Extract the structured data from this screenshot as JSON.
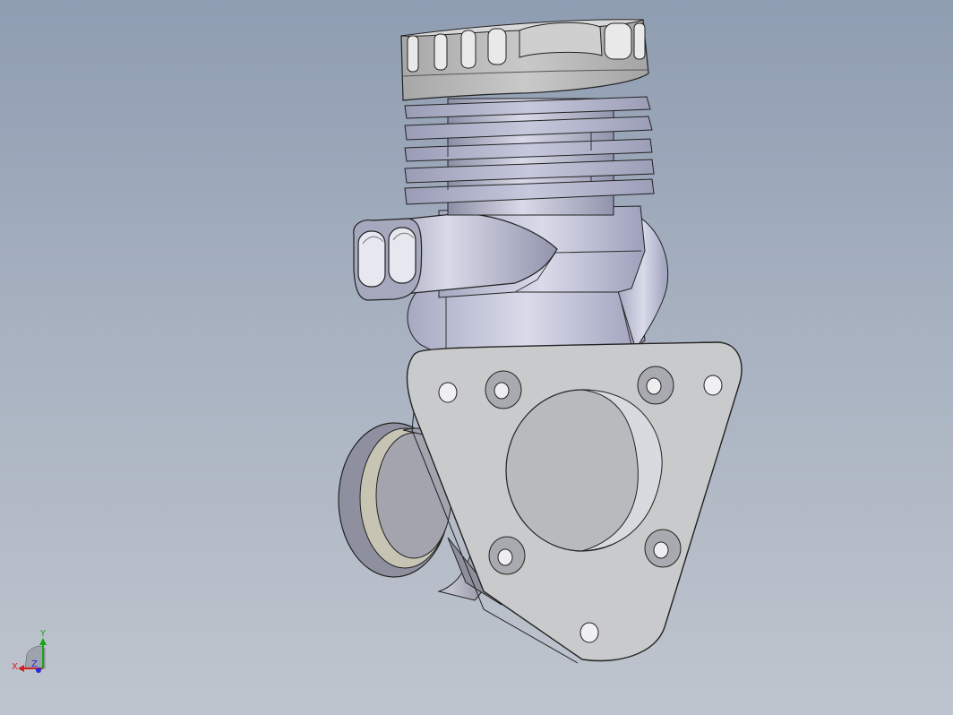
{
  "viewport": {
    "background_top": "#8f9db2",
    "background_bottom": "#bfc5ce",
    "model": "engine-part-assembly"
  },
  "triad": {
    "x_label": "X",
    "y_label": "Y",
    "z_label": "Z",
    "x_color": "#d12020",
    "y_color": "#1aa51a",
    "z_color": "#2a2ad0"
  }
}
